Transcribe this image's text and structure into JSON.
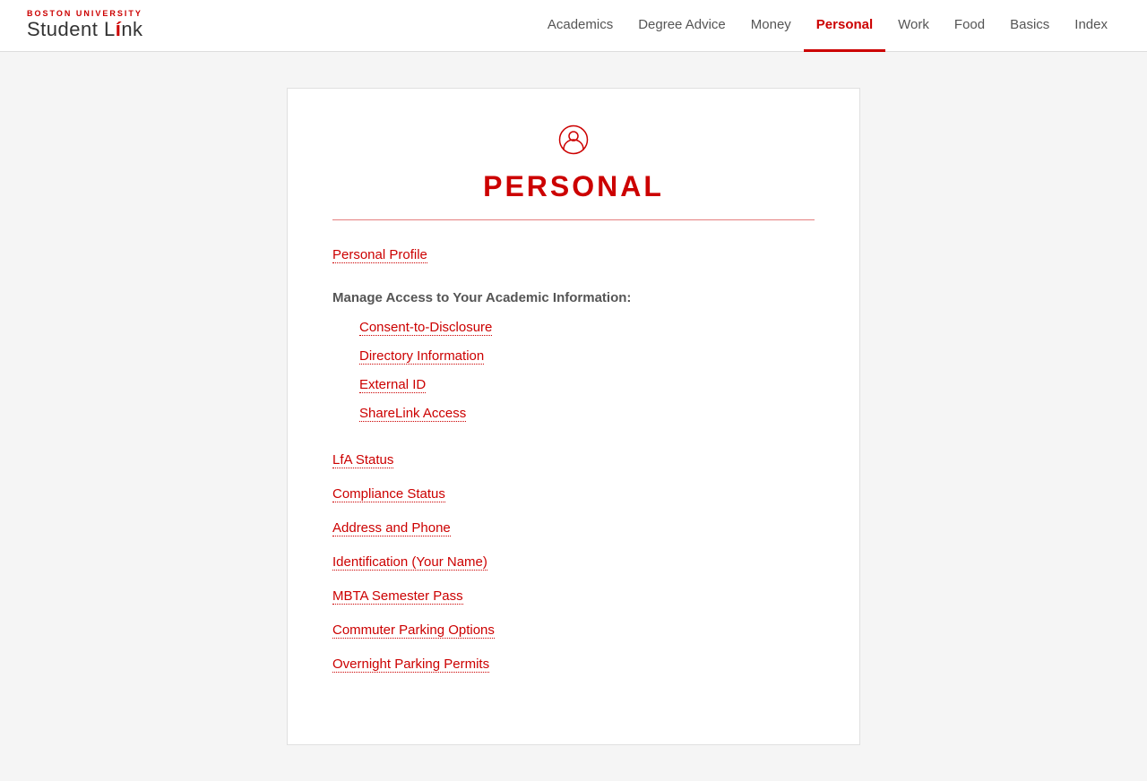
{
  "header": {
    "logo": {
      "bu_text": "BOSTON UNIVERSITY",
      "title": "Student L",
      "title_accent": "i",
      "title_end": "nk"
    },
    "nav": [
      {
        "label": "Academics",
        "active": false
      },
      {
        "label": "Degree Advice",
        "active": false
      },
      {
        "label": "Money",
        "active": false
      },
      {
        "label": "Personal",
        "active": true
      },
      {
        "label": "Work",
        "active": false
      },
      {
        "label": "Food",
        "active": false
      },
      {
        "label": "Basics",
        "active": false
      },
      {
        "label": "Index",
        "active": false
      }
    ]
  },
  "page": {
    "icon": "👤",
    "title": "PERSONAL",
    "personal_profile_label": "Personal Profile",
    "manage_heading": "Manage Access to Your Academic Information:",
    "sub_links": [
      {
        "label": "Consent-to-Disclosure"
      },
      {
        "label": "Directory Information"
      },
      {
        "label": "External ID"
      },
      {
        "label": "ShareLink Access"
      }
    ],
    "main_links": [
      {
        "label": "LfA Status"
      },
      {
        "label": "Compliance Status"
      },
      {
        "label": "Address and Phone"
      },
      {
        "label": "Identification (Your Name)"
      },
      {
        "label": "MBTA Semester Pass"
      },
      {
        "label": "Commuter Parking Options"
      },
      {
        "label": "Overnight Parking Permits"
      }
    ]
  }
}
